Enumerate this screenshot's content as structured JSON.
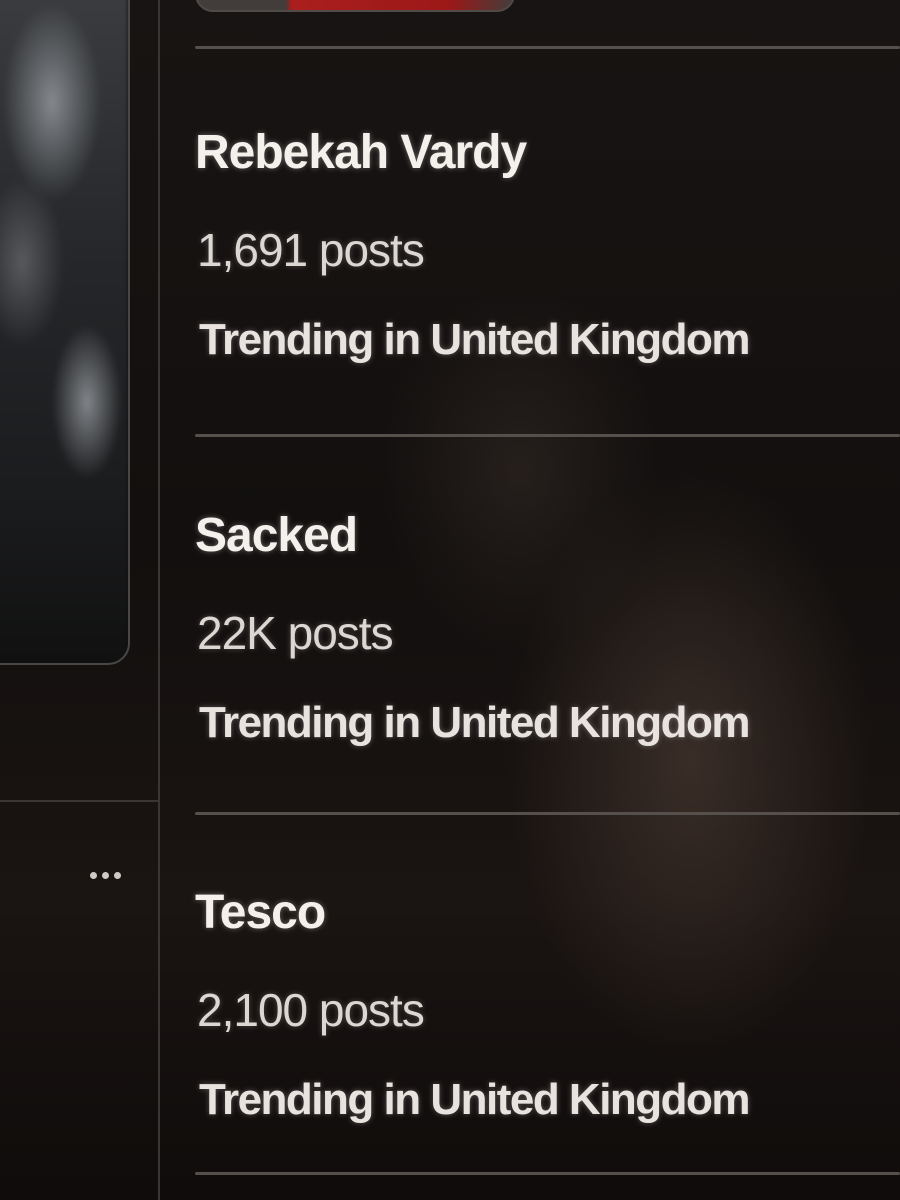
{
  "left_panel": {
    "more_icon": "more-horizontal-icon"
  },
  "trends": [
    {
      "title": "Rebekah Vardy",
      "count": "1,691 posts",
      "context": "Trending in United Kingdom"
    },
    {
      "title": "Sacked",
      "count": "22K posts",
      "context": "Trending in United Kingdom"
    },
    {
      "title": "Tesco",
      "count": "2,100 posts",
      "context": "Trending in United Kingdom"
    }
  ],
  "colors": {
    "background": "#0d0b0a",
    "text_primary": "#f4f0ec",
    "divider": "#55504c"
  }
}
